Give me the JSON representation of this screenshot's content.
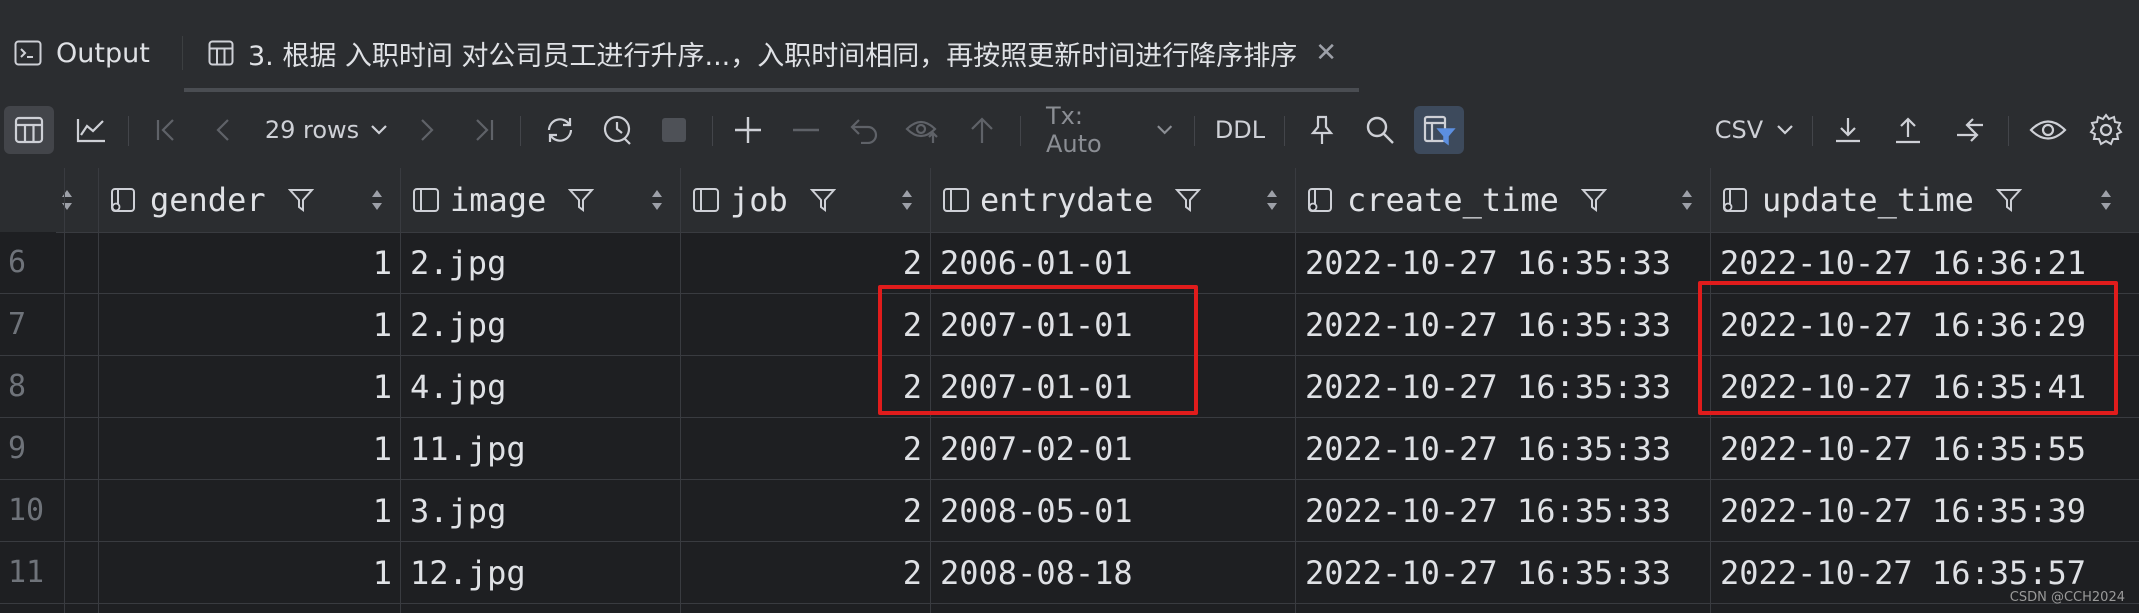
{
  "tabs": {
    "output_label": "Output",
    "query_label": "3. 根据 入职时间 对公司员工进行升序...，入职时间相同，再按照更新时间进行降序排序"
  },
  "toolbar": {
    "rows_label": "29 rows",
    "tx_label": "Tx: Auto",
    "ddl_label": "DDL",
    "export_format": "CSV"
  },
  "columns": [
    "gender",
    "image",
    "job",
    "entrydate",
    "create_time",
    "update_time"
  ],
  "rows": [
    {
      "n": "6",
      "gender": "1",
      "image": "2.jpg",
      "job": "2",
      "entrydate": "2006-01-01",
      "create_time": "2022-10-27 16:35:33",
      "update_time": "2022-10-27 16:36:21"
    },
    {
      "n": "7",
      "gender": "1",
      "image": "2.jpg",
      "job": "2",
      "entrydate": "2007-01-01",
      "create_time": "2022-10-27 16:35:33",
      "update_time": "2022-10-27 16:36:29"
    },
    {
      "n": "8",
      "gender": "1",
      "image": "4.jpg",
      "job": "2",
      "entrydate": "2007-01-01",
      "create_time": "2022-10-27 16:35:33",
      "update_time": "2022-10-27 16:35:41"
    },
    {
      "n": "9",
      "gender": "1",
      "image": "11.jpg",
      "job": "2",
      "entrydate": "2007-02-01",
      "create_time": "2022-10-27 16:35:33",
      "update_time": "2022-10-27 16:35:55"
    },
    {
      "n": "10",
      "gender": "1",
      "image": "3.jpg",
      "job": "2",
      "entrydate": "2008-05-01",
      "create_time": "2022-10-27 16:35:33",
      "update_time": "2022-10-27 16:35:39"
    },
    {
      "n": "11",
      "gender": "1",
      "image": "12.jpg",
      "job": "2",
      "entrydate": "2008-08-18",
      "create_time": "2022-10-27 16:35:33",
      "update_time": "2022-10-27 16:35:57"
    }
  ],
  "watermark": "CSDN @CCH2024",
  "colors": {
    "highlight": "#e01c1c",
    "background": "#1e1f22",
    "toolbar": "#2b2d30"
  }
}
